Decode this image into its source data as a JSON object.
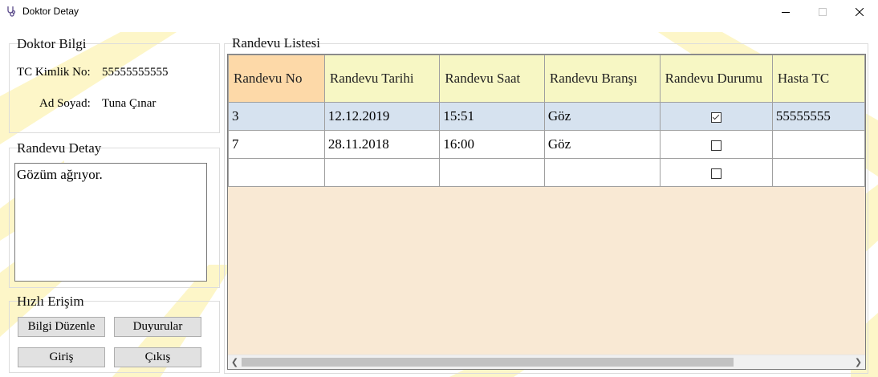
{
  "window": {
    "title": "Doktor Detay",
    "icon": "stethoscope-icon",
    "controls": [
      "minimize-icon",
      "maximize-icon",
      "close-icon"
    ]
  },
  "doktor_bilgi": {
    "legend": "Doktor Bilgi",
    "tc_label": "TC Kimlik No:",
    "tc_value": "55555555555",
    "name_label": "Ad Soyad:",
    "name_value": "Tuna Çınar"
  },
  "randevu_detay": {
    "legend": "Randevu Detay",
    "text": "Gözüm ağrıyor."
  },
  "hizli_erisim": {
    "legend": "Hızlı Erişim",
    "buttons": {
      "bilgi_duzenle": "Bilgi Düzenle",
      "duyurular": "Duyurular",
      "giris": "Giriş",
      "cikis": "Çıkış"
    }
  },
  "randevu_listesi": {
    "legend": "Randevu Listesi",
    "columns": [
      "Randevu No",
      "Randevu Tarihi",
      "Randevu Saat",
      "Randevu Branşı",
      "Randevu Durumu",
      "Hasta TC"
    ],
    "rows": [
      {
        "no": "3",
        "tarih": "12.12.2019",
        "saat": "15:51",
        "brans": "Göz",
        "durum": true,
        "hasta_tc": "55555555"
      },
      {
        "no": "7",
        "tarih": "28.11.2018",
        "saat": "16:00",
        "brans": "Göz",
        "durum": false,
        "hasta_tc": ""
      },
      {
        "no": "",
        "tarih": "",
        "saat": "",
        "brans": "",
        "durum": false,
        "hasta_tc": ""
      }
    ],
    "selected_row": 0,
    "scroll_left_icon": "chevron-left-icon",
    "scroll_right_icon": "chevron-right-icon"
  },
  "colors": {
    "header_bg": "#f7f7c4",
    "sorted_header_bg": "#fdd9a8",
    "selected_row_bg": "#d6e2ef",
    "grid_empty_bg": "#f9e9d4",
    "decor_yellow": "#fdf6c8"
  }
}
